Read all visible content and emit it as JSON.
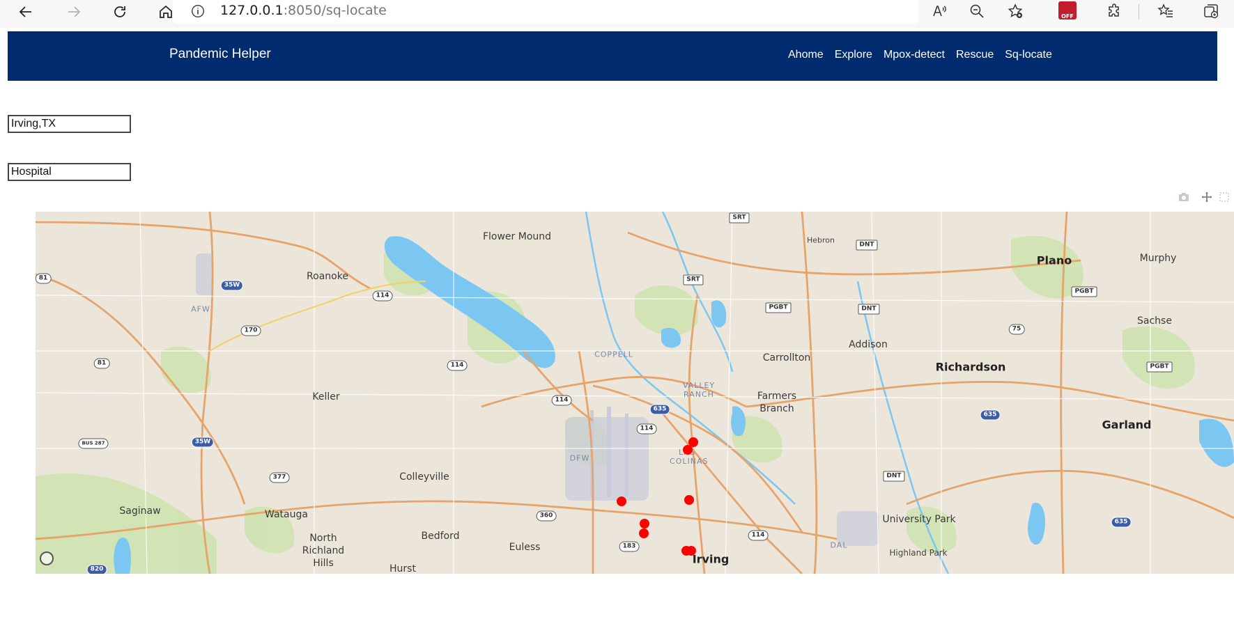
{
  "browser": {
    "url_host": "127.0.0.1",
    "url_rest": ":8050/sq-locate",
    "off_badge": "OFF"
  },
  "navbar": {
    "brand": "Pandemic Helper",
    "links": [
      "Ahome",
      "Explore",
      "Mpox-detect",
      "Rescue",
      "Sq-locate"
    ]
  },
  "form": {
    "location_value": "Irving,TX",
    "place_value": "Hospital"
  },
  "map": {
    "marker_color": "#ff0000",
    "water_color": "#7cc6f2",
    "road_color": "#e6a36a",
    "labels": {
      "flower_mound": "Flower Mound",
      "hebron": "Hebron",
      "plano": "Plano",
      "murphy": "Murphy",
      "roanoke": "Roanoke",
      "afw": "AFW",
      "sachse": "Sachse",
      "addison": "Addison",
      "coppell": "COPPELL",
      "carrollton": "Carrollton",
      "richardson": "Richardson",
      "keller": "Keller",
      "valley_ranch": "VALLEY RANCH",
      "farmers_branch": "Farmers Branch",
      "garland": "Garland",
      "dfw": "DFW",
      "las_colinas": "LAS COLINAS",
      "colleyville": "Colleyville",
      "saginaw": "Saginaw",
      "watauga": "Watauga",
      "university_park": "University Park",
      "bedford": "Bedford",
      "north_richland_hills": "North Richland Hills",
      "euless": "Euless",
      "irving": "Irving",
      "dal": "DAL",
      "highland_park": "Highland Park",
      "hurst": "Hurst"
    },
    "shields": {
      "srt1": "SRT",
      "srt2": "SRT",
      "dnt1": "DNT",
      "dnt2": "DNT",
      "dnt3": "DNT",
      "pgbt1": "PGBT",
      "pgbt2": "PGBT",
      "pgbt3": "PGBT",
      "r81a": "81",
      "r81b": "81",
      "r35w1": "35W",
      "r35w2": "35W",
      "r170": "170",
      "r114a": "114",
      "r114b": "114",
      "r114c": "114",
      "r114d": "114",
      "r114e": "114",
      "r75": "75",
      "r635a": "635",
      "r635b": "635",
      "r635c": "635",
      "bus287": "BUS 287",
      "r377": "377",
      "r360": "360",
      "r183": "183",
      "r820": "820"
    }
  }
}
